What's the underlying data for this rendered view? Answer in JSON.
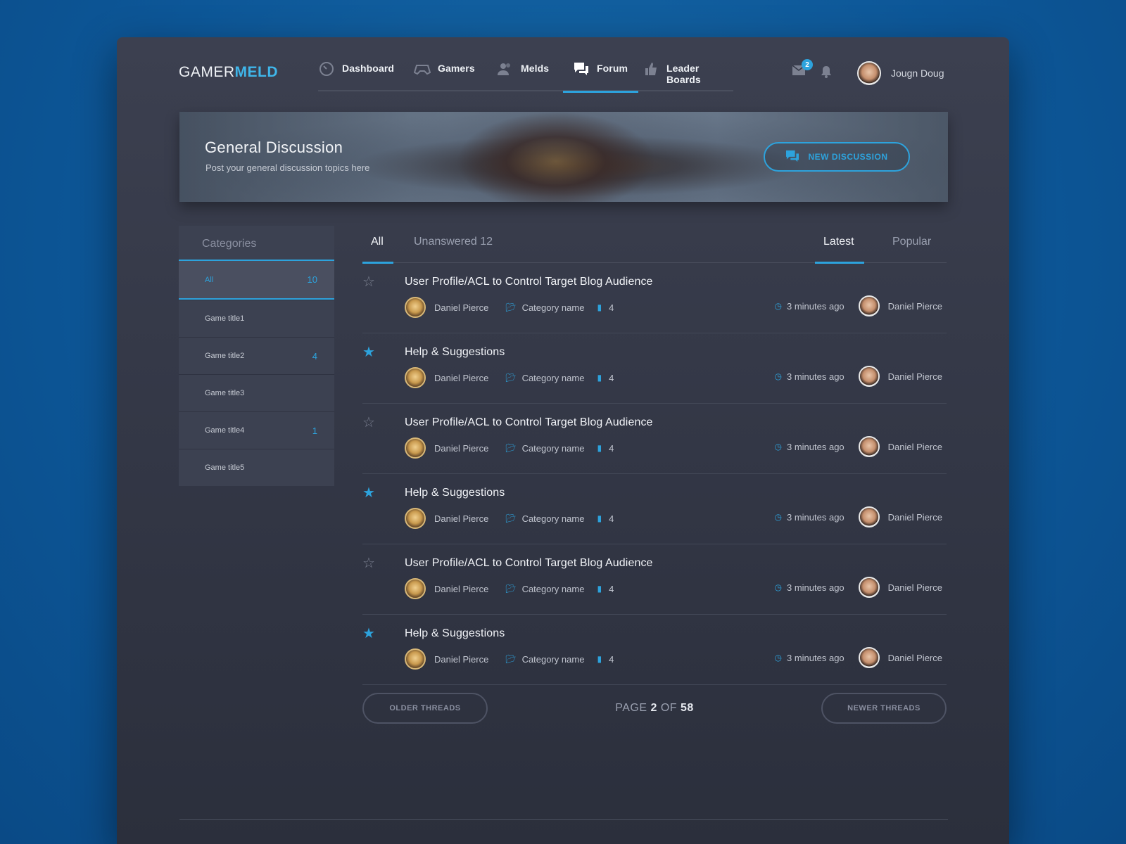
{
  "brand": {
    "part1": "GAMER",
    "part2": "MELD"
  },
  "nav": [
    {
      "label": "Dashboard",
      "icon": "speedometer-icon"
    },
    {
      "label": "Gamers",
      "icon": "gamepad-icon"
    },
    {
      "label": "Melds",
      "icon": "users-icon"
    },
    {
      "label": "Forum",
      "icon": "chat-icon",
      "active": true
    },
    {
      "label": "Leader Boards",
      "icon": "thumbs-up-icon"
    }
  ],
  "header": {
    "mail_badge": "2",
    "user_name": "Jougn Doug"
  },
  "banner": {
    "title": "General Discussion",
    "subtitle": "Post your general discussion topics here",
    "button": "NEW DISCUSSION"
  },
  "sidebar": {
    "heading": "Categories",
    "items": [
      {
        "label": "All",
        "count": "10"
      },
      {
        "label": "Game title1",
        "count": ""
      },
      {
        "label": "Game title2",
        "count": "4"
      },
      {
        "label": "Game title3",
        "count": ""
      },
      {
        "label": "Game title4",
        "count": "1"
      },
      {
        "label": "Game title5",
        "count": ""
      }
    ]
  },
  "tabs": {
    "all": "All",
    "unanswered": "Unanswered 12",
    "latest": "Latest",
    "popular": "Popular"
  },
  "threads": [
    {
      "title": "User Profile/ACL to Control Target Blog Audience",
      "author": "Daniel Pierce",
      "category": "Category name",
      "replies": "4",
      "time": "3 minutes ago",
      "last_user": "Daniel Pierce",
      "starred": false
    },
    {
      "title": "Help & Suggestions",
      "author": "Daniel Pierce",
      "category": "Category name",
      "replies": "4",
      "time": "3 minutes ago",
      "last_user": "Daniel Pierce",
      "starred": true
    },
    {
      "title": "User Profile/ACL to Control Target Blog Audience",
      "author": "Daniel Pierce",
      "category": "Category name",
      "replies": "4",
      "time": "3 minutes ago",
      "last_user": "Daniel Pierce",
      "starred": false
    },
    {
      "title": "Help & Suggestions",
      "author": "Daniel Pierce",
      "category": "Category name",
      "replies": "4",
      "time": "3 minutes ago",
      "last_user": "Daniel Pierce",
      "starred": true
    },
    {
      "title": "User Profile/ACL to Control Target Blog Audience",
      "author": "Daniel Pierce",
      "category": "Category name",
      "replies": "4",
      "time": "3 minutes ago",
      "last_user": "Daniel Pierce",
      "starred": false
    },
    {
      "title": "Help & Suggestions",
      "author": "Daniel Pierce",
      "category": "Category name",
      "replies": "4",
      "time": "3 minutes ago",
      "last_user": "Daniel Pierce",
      "starred": true
    }
  ],
  "pager": {
    "older": "OLDER THREADS",
    "newer": "NEWER THREADS",
    "page_word": "PAGE",
    "page": "2",
    "of_word": "OF",
    "total": "58"
  },
  "colors": {
    "accent": "#2da3dd",
    "background": "#0d5798",
    "panel": "#343847"
  }
}
